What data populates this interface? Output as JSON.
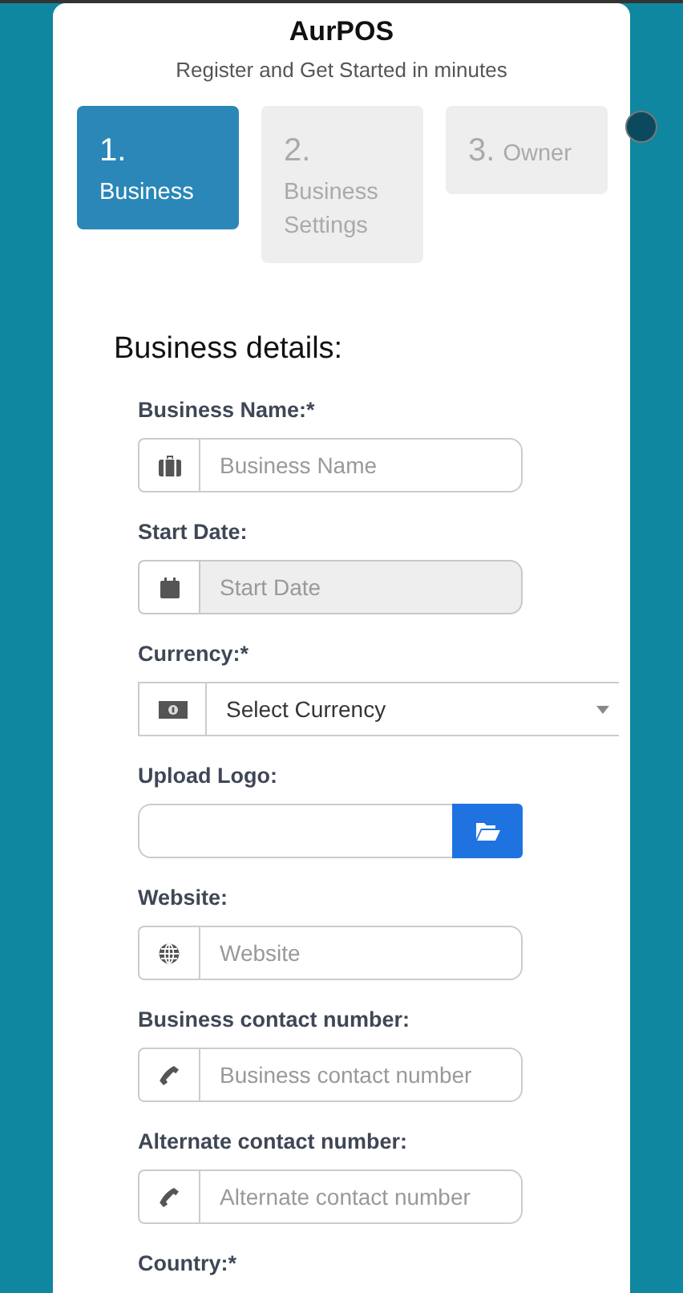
{
  "header": {
    "title": "AurPOS",
    "subtitle": "Register and Get Started in minutes"
  },
  "steps": [
    {
      "number": "1.",
      "label": "Business",
      "selected": true
    },
    {
      "number": "2.",
      "label": "Business Settings",
      "selected": false
    },
    {
      "number": "3.",
      "label": "Owner",
      "selected": false
    }
  ],
  "section_title": "Business details:",
  "fields": [
    {
      "label": "Business Name:*",
      "kind": "text",
      "placeholder": "Business Name",
      "disabled": false
    },
    {
      "label": "Start Date:",
      "kind": "date",
      "placeholder": "Start Date",
      "disabled": true
    },
    {
      "label": "Currency:*",
      "kind": "select",
      "value": "Select Currency"
    },
    {
      "label": "Upload Logo:",
      "kind": "file"
    },
    {
      "label": "Website:",
      "kind": "url",
      "placeholder": "Website",
      "disabled": false
    },
    {
      "label": "Business contact number:",
      "kind": "phone",
      "placeholder": "Business contact number",
      "disabled": false
    },
    {
      "label": "Alternate contact number:",
      "kind": "phone",
      "placeholder": "Alternate contact number",
      "disabled": false
    },
    {
      "label": "Country:*",
      "kind": "cut"
    }
  ]
}
